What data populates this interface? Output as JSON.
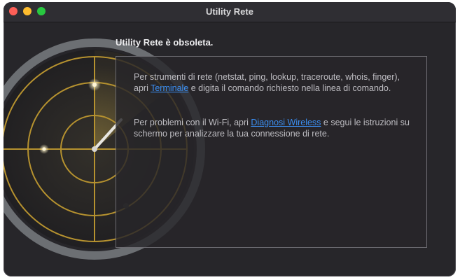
{
  "window": {
    "title": "Utility Rete"
  },
  "content": {
    "heading": "Utility Rete è obsoleta.",
    "paragraph1": {
      "before": "Per strumenti di rete (netstat, ping, lookup, traceroute, whois, finger), apri ",
      "link": "Terminale",
      "after": " e digita il comando richiesto nella linea di comando."
    },
    "paragraph2": {
      "before": "Per problemi con il Wi-Fi, apri ",
      "link": "Diagnosi Wireless",
      "after": " e segui le istruzioni su schermo per analizzare la tua connessione di rete."
    }
  },
  "colors": {
    "window_bg": "#27262a",
    "link": "#3b8ff3",
    "radar_gold": "#c9a43a"
  },
  "icons": {
    "close": "close-icon",
    "minimize": "minimize-icon",
    "zoom": "zoom-icon",
    "radar": "radar-icon"
  }
}
